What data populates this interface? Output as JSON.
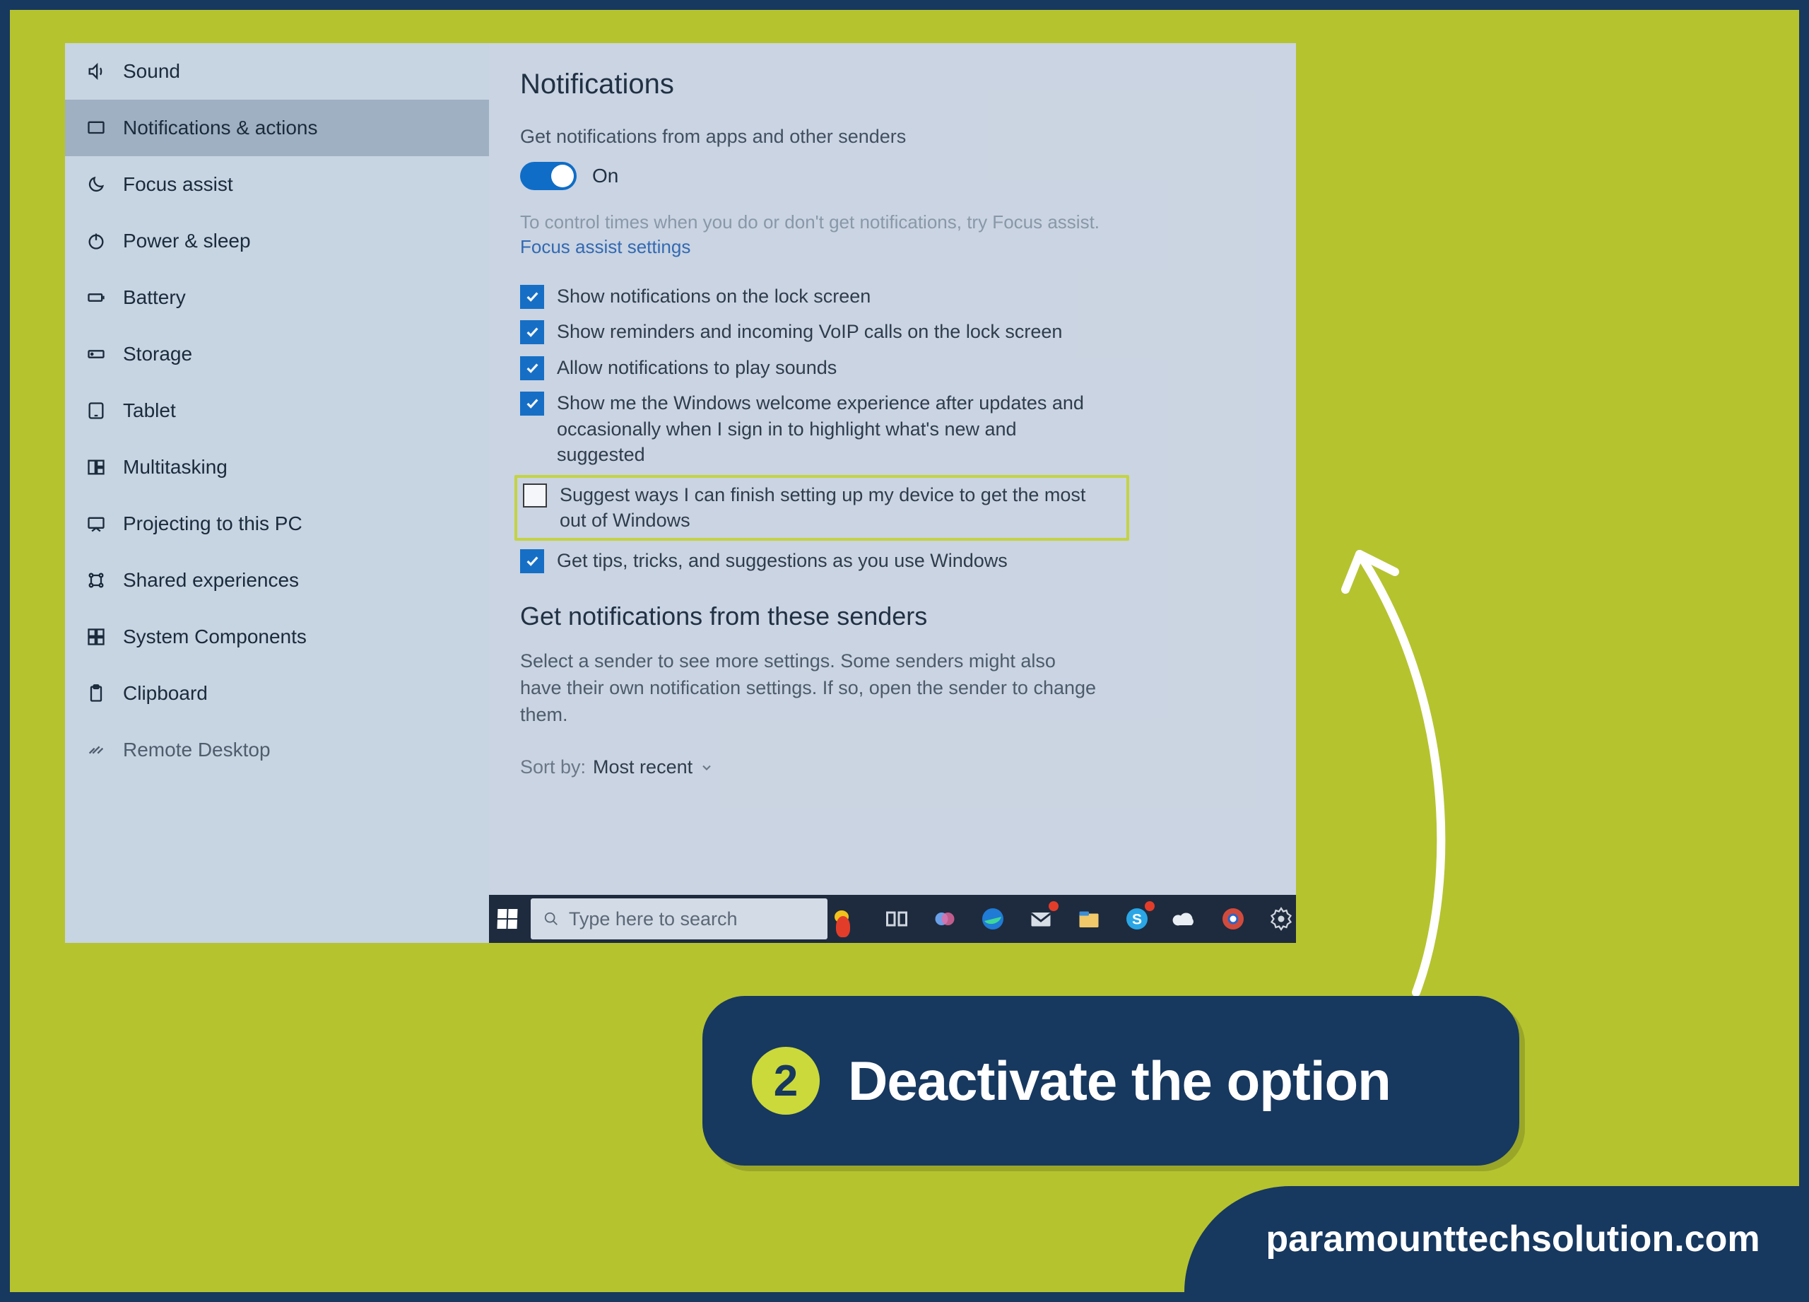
{
  "sidebar": {
    "items": [
      {
        "label": "Sound"
      },
      {
        "label": "Notifications & actions"
      },
      {
        "label": "Focus assist"
      },
      {
        "label": "Power & sleep"
      },
      {
        "label": "Battery"
      },
      {
        "label": "Storage"
      },
      {
        "label": "Tablet"
      },
      {
        "label": "Multitasking"
      },
      {
        "label": "Projecting to this PC"
      },
      {
        "label": "Shared experiences"
      },
      {
        "label": "System Components"
      },
      {
        "label": "Clipboard"
      },
      {
        "label": "Remote Desktop"
      }
    ]
  },
  "main": {
    "title": "Notifications",
    "setting_label": "Get notifications from apps and other senders",
    "toggle_state": "On",
    "hint": "To control times when you do or don't get notifications, try Focus assist.",
    "link": "Focus assist settings",
    "checks": [
      {
        "label": "Show notifications on the lock screen"
      },
      {
        "label": "Show reminders and incoming VoIP calls on the lock screen"
      },
      {
        "label": "Allow notifications to play sounds"
      },
      {
        "label": "Show me the Windows welcome experience after updates and occasionally when I sign in to highlight what's new and suggested"
      },
      {
        "label": "Suggest ways I can finish setting up my device to get the most out of Windows"
      },
      {
        "label": "Get tips, tricks, and suggestions as you use Windows"
      }
    ],
    "section2_title": "Get notifications from these senders",
    "section2_desc": "Select a sender to see more settings. Some senders might also have their own notification settings. If so, open the sender to change them.",
    "sort_label": "Sort by:",
    "sort_value": "Most recent"
  },
  "taskbar": {
    "search_placeholder": "Type here to search"
  },
  "callout": {
    "step": "2",
    "text": "Deactivate the option"
  },
  "watermark": "paramounttechsolution.com"
}
